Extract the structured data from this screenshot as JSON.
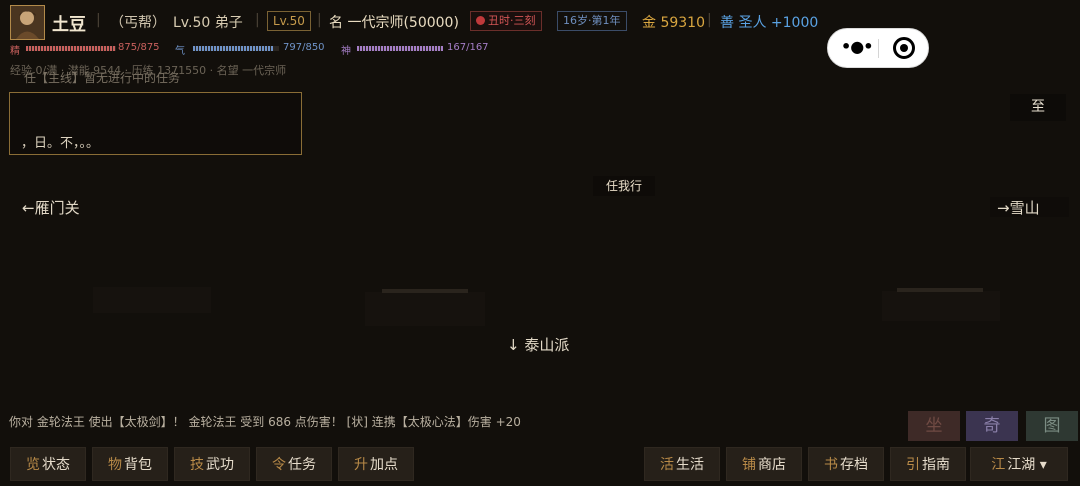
{
  "header": {
    "name": "土豆",
    "sect": "（丐帮）",
    "level_title": "Lv.50 弟子",
    "level_box": "Lv.50",
    "rank": "名 一代宗师(50000)",
    "time_badge": "丑时·三刻",
    "age_badge": "16岁·第1年",
    "gold": "金 59310",
    "karma": "善 圣人 +1000"
  },
  "stats": {
    "jing": {
      "label": "精",
      "value": "875/875",
      "fill": 1.0,
      "color": "#c9605d"
    },
    "qi": {
      "label": "气",
      "value": "797/850",
      "fill": 0.94,
      "color": "#6f93c8"
    },
    "shen": {
      "label": "神",
      "value": "167/167",
      "fill": 1.0,
      "color": "#a57ec7"
    }
  },
  "sub_info": "经验 0/满  ·  潜能 9544  ·  历练 1371550  ·  名望 一代宗师",
  "quest_line": "任【主线】暂无进行中的任务",
  "panel": {
    "text": "，日。不，。。"
  },
  "top_right_button": "至",
  "scene": {
    "npc": "任我行",
    "exit_west": "←雁门关",
    "exit_east": "→雪山",
    "exit_south": "↓ 泰山派"
  },
  "log": "你对 金轮法王 使出【太极剑】！ 金轮法王 受到 686 点伤害！ [状] 连携【太极心法】伤害 +20",
  "tiles": [
    {
      "label": "坐",
      "bg": "#3e2a27",
      "fg": "#6f4a43"
    },
    {
      "label": "奇",
      "bg": "#3b3450",
      "fg": "#8a7fa8"
    },
    {
      "label": "图",
      "bg": "#2e3832",
      "fg": "#7b8c83"
    }
  ],
  "bottom_left": [
    {
      "prefix": "览",
      "label": "状态"
    },
    {
      "prefix": "物",
      "label": "背包"
    },
    {
      "prefix": "技",
      "label": "武功"
    },
    {
      "prefix": "令",
      "label": "任务"
    },
    {
      "prefix": "升",
      "label": "加点"
    }
  ],
  "bottom_right": [
    {
      "prefix": "活",
      "label": "生活"
    },
    {
      "prefix": "铺",
      "label": "商店"
    },
    {
      "prefix": "书",
      "label": "存档"
    },
    {
      "prefix": "引",
      "label": "指南"
    },
    {
      "prefix": "江",
      "label": "江湖 ▾"
    }
  ]
}
